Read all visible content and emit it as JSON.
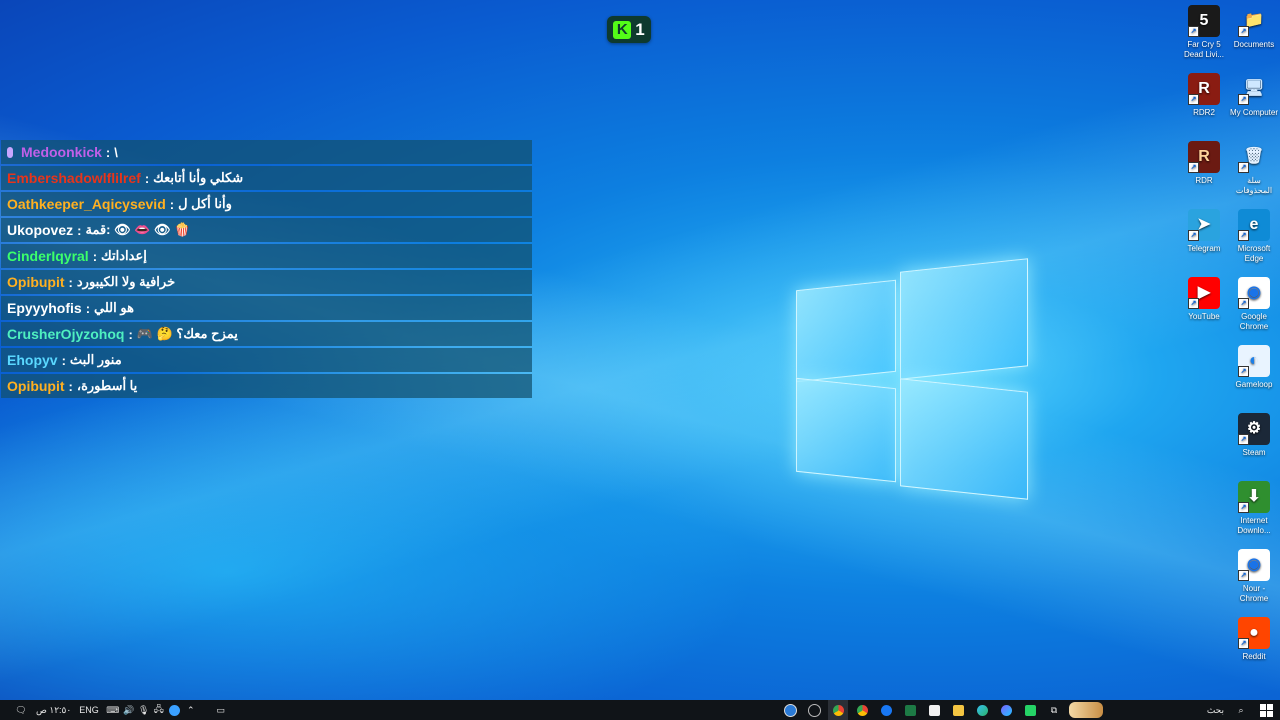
{
  "kick_badge": {
    "letter": "K",
    "count": "1",
    "color": "#53fc18"
  },
  "chat": [
    {
      "user": "Medoonkick",
      "text": "\\",
      "color": "#c060e8",
      "icon": "mic-icon"
    },
    {
      "user": "Embershadowlflilref",
      "text": "شكلي وأنا أتابعك",
      "color": "#e8341a"
    },
    {
      "user": "Oathkeeper_Aqicysevid",
      "text": "وأنا أكل ل",
      "color": "#ffb020"
    },
    {
      "user": "Ukopovez",
      "text": "قمة: 👁 👄 👁 🍿",
      "color": "#ffffff"
    },
    {
      "user": "CinderIqyral",
      "text": "إعداداتك",
      "color": "#3bff6b"
    },
    {
      "user": "Opibupit",
      "text": "خرافية ولا الكيبورد",
      "color": "#ffb020"
    },
    {
      "user": "Epyyyhofis",
      "text": "هو اللي",
      "color": "#ffffff"
    },
    {
      "user": "CrusherOjyzohoq",
      "text": "🎮 🤔 يمزح معك؟",
      "color": "#4ff0c0"
    },
    {
      "user": "Ehopyv",
      "text": "منور البث",
      "color": "#5ad8ff"
    },
    {
      "user": "Opibupit",
      "text": "،يا أسطورة",
      "color": "#ffb020"
    }
  ],
  "desktop_icons": [
    {
      "id": "farcry",
      "label": "Far Cry 5 Dead Livi...",
      "glyph": "5",
      "bg": "#1a1a1a",
      "fg": "#ffffff",
      "icon": "far-cry-icon"
    },
    {
      "id": "documents",
      "label": "Documents",
      "glyph": "📁",
      "bg": "transparent",
      "fg": "#f4c542",
      "icon": "folder-icon"
    },
    {
      "id": "rdr2",
      "label": "RDR2",
      "glyph": "R",
      "bg": "#8a1c12",
      "fg": "#ffffff",
      "icon": "rdr2-icon"
    },
    {
      "id": "mycomputer",
      "label": "My Computer",
      "glyph": "🖥",
      "bg": "transparent",
      "fg": "#cfe8ff",
      "icon": "computer-icon"
    },
    {
      "id": "rdr",
      "label": "RDR",
      "glyph": "R",
      "bg": "#6b1a12",
      "fg": "#ffd39a",
      "icon": "rdr-icon"
    },
    {
      "id": "recycle",
      "label": "سلة المحذوفات",
      "glyph": "🗑",
      "bg": "transparent",
      "fg": "#e6f2ff",
      "icon": "recycle-bin-icon"
    },
    {
      "id": "telegram",
      "label": "Telegram",
      "glyph": "➤",
      "bg": "#2aa3df",
      "fg": "#ffffff",
      "icon": "telegram-icon"
    },
    {
      "id": "edge",
      "label": "Microsoft Edge",
      "glyph": "e",
      "bg": "#0f8bd6",
      "fg": "#ffffff",
      "icon": "edge-icon"
    },
    {
      "id": "youtube",
      "label": "YouTube",
      "glyph": "▶",
      "bg": "#ff0000",
      "fg": "#ffffff",
      "icon": "youtube-icon"
    },
    {
      "id": "chrome",
      "label": "Google Chrome",
      "glyph": "◉",
      "bg": "#ffffff",
      "fg": "#1a73e8",
      "icon": "chrome-icon"
    },
    {
      "id": "gameloop",
      "label": "Gameloop",
      "glyph": "◐",
      "bg": "#e9f4ff",
      "fg": "#1b7fe8",
      "icon": "gameloop-icon"
    },
    {
      "id": "steam",
      "label": "Steam",
      "glyph": "⚙",
      "bg": "#1b2838",
      "fg": "#ffffff",
      "icon": "steam-icon"
    },
    {
      "id": "idm",
      "label": "Internet Downlo...",
      "glyph": "⬇",
      "bg": "#2f8f2f",
      "fg": "#ffffff",
      "icon": "internet-download-manager-icon"
    },
    {
      "id": "nour",
      "label": "Nour - Chrome",
      "glyph": "◉",
      "bg": "#ffffff",
      "fg": "#1a73e8",
      "icon": "chrome-profile-icon"
    },
    {
      "id": "reddit",
      "label": "Reddit",
      "glyph": "●",
      "bg": "#ff4500",
      "fg": "#ffffff",
      "icon": "reddit-icon"
    }
  ],
  "taskbar": {
    "lang": "ENG",
    "time": "١٢:٥٠ ص",
    "search_label": "بحث"
  }
}
